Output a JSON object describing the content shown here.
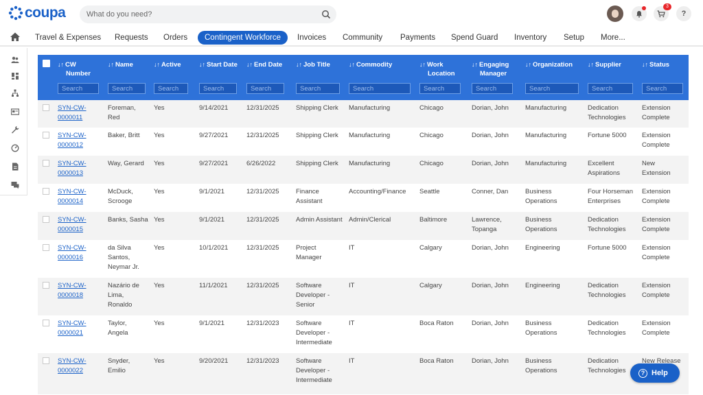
{
  "brand": {
    "logo_text": "coupa",
    "accent": "#1a61c8",
    "header_blue": "#2e72d9"
  },
  "search": {
    "placeholder": "What do you need?"
  },
  "header_icons": {
    "cart_count": "3"
  },
  "nav": {
    "items": [
      "Travel & Expenses",
      "Requests",
      "Orders",
      "Contingent Workforce",
      "Invoices",
      "Community",
      "Payments",
      "Spend Guard",
      "Inventory",
      "Setup",
      "More..."
    ],
    "active": "Contingent Workforce"
  },
  "sidebar": {
    "icons": [
      "users-icon",
      "dashboard-icon",
      "hierarchy-icon",
      "card-icon",
      "wrench-icon",
      "gauge-icon",
      "document-icon",
      "chat-icon"
    ]
  },
  "table": {
    "columns": [
      {
        "label": "CW\nNumber",
        "search": "Search"
      },
      {
        "label": "Name",
        "search": "Search"
      },
      {
        "label": "Active",
        "search": "Search"
      },
      {
        "label": "Start Date",
        "search": "Search"
      },
      {
        "label": "End Date",
        "search": "Search"
      },
      {
        "label": "Job Title",
        "search": "Search"
      },
      {
        "label": "Commodity",
        "search": "Search"
      },
      {
        "label": "Work\nLocation",
        "search": "Search"
      },
      {
        "label": "Engaging\nManager",
        "search": "Search"
      },
      {
        "label": "Organization",
        "search": "Search"
      },
      {
        "label": "Supplier",
        "search": "Search"
      },
      {
        "label": "Status",
        "search": "Search"
      }
    ],
    "rows": [
      [
        "SYN-CW-\n0000011",
        "Foreman,\nRed",
        "Yes",
        "9/14/2021",
        "12/31/2025",
        "Shipping Clerk",
        "Manufacturing",
        "Chicago",
        "Dorian, John",
        "Manufacturing",
        "Dedication\nTechnologies",
        "Extension\nComplete"
      ],
      [
        "SYN-CW-\n0000012",
        "Baker, Britt",
        "Yes",
        "9/27/2021",
        "12/31/2025",
        "Shipping Clerk",
        "Manufacturing",
        "Chicago",
        "Dorian, John",
        "Manufacturing",
        "Fortune 5000",
        "Extension\nComplete"
      ],
      [
        "SYN-CW-\n0000013",
        "Way, Gerard",
        "Yes",
        "9/27/2021",
        "6/26/2022",
        "Shipping Clerk",
        "Manufacturing",
        "Chicago",
        "Dorian, John",
        "Manufacturing",
        "Excellent\nAspirations",
        "New\nExtension"
      ],
      [
        "SYN-CW-\n0000014",
        "McDuck,\nScrooge",
        "Yes",
        "9/1/2021",
        "12/31/2025",
        "Finance\nAssistant",
        "Accounting/Finance",
        "Seattle",
        "Conner, Dan",
        "Business\nOperations",
        "Four Horseman\nEnterprises",
        "Extension\nComplete"
      ],
      [
        "SYN-CW-\n0000015",
        "Banks, Sasha",
        "Yes",
        "9/1/2021",
        "12/31/2025",
        "Admin Assistant",
        "Admin/Clerical",
        "Baltimore",
        "Lawrence,\nTopanga",
        "Business\nOperations",
        "Dedication\nTechnologies",
        "Extension\nComplete"
      ],
      [
        "SYN-CW-\n0000016",
        "da Silva\nSantos,\nNeymar Jr.",
        "Yes",
        "10/1/2021",
        "12/31/2025",
        "Project\nManager",
        "IT",
        "Calgary",
        "Dorian, John",
        "Engineering",
        "Fortune 5000",
        "Extension\nComplete"
      ],
      [
        "SYN-CW-\n0000018",
        "Nazário de\nLima,\nRonaldo",
        "Yes",
        "11/1/2021",
        "12/31/2025",
        "Software\nDeveloper -\nSenior",
        "IT",
        "Calgary",
        "Dorian, John",
        "Engineering",
        "Dedication\nTechnologies",
        "Extension\nComplete"
      ],
      [
        "SYN-CW-\n0000021",
        "Taylor,\nAngela",
        "Yes",
        "9/1/2021",
        "12/31/2023",
        "Software\nDeveloper -\nIntermediate",
        "IT",
        "Boca Raton",
        "Dorian, John",
        "Business\nOperations",
        "Dedication\nTechnologies",
        "Extension\nComplete"
      ],
      [
        "SYN-CW-\n0000022",
        "Snyder,\nEmilio",
        "Yes",
        "9/20/2021",
        "12/31/2023",
        "Software\nDeveloper -\nIntermediate",
        "IT",
        "Boca Raton",
        "Dorian, John",
        "Business\nOperations",
        "Dedication\nTechnologies",
        "New Release"
      ]
    ]
  },
  "help": {
    "label": "Help"
  }
}
